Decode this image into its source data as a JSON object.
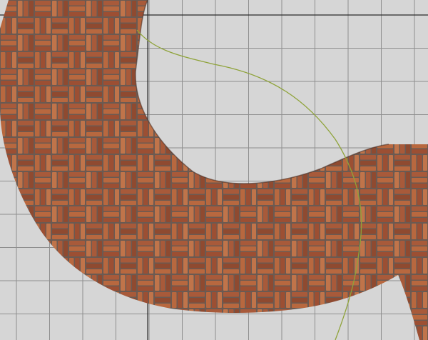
{
  "viewport": {
    "name": "3d-editor-viewport",
    "background_color": "#d6d6d6",
    "grid_color": "#8f8f8f",
    "axis_color": "#2a2a2a",
    "guide_curve_color": "#8fa33a",
    "paving_material": "brick-basketweave",
    "brick_colors": [
      "#a85a3a",
      "#b8683f",
      "#9c4f33",
      "#c0744a",
      "#8f4a30"
    ],
    "mortar_color": "#6b5a52"
  }
}
